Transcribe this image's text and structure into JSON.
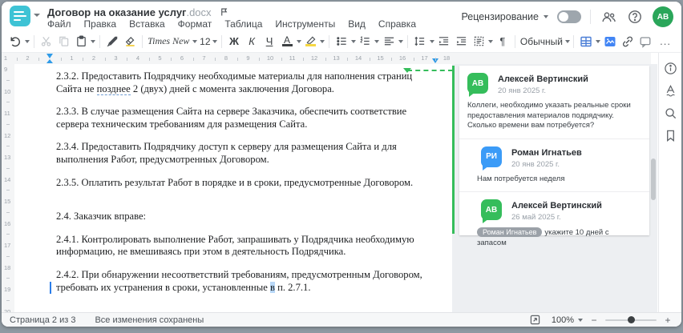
{
  "window": {
    "title": "Договор на оказание услуг",
    "title_extension": ".docx"
  },
  "menu": {
    "items": [
      "Файл",
      "Правка",
      "Вставка",
      "Формат",
      "Таблица",
      "Инструменты",
      "Вид",
      "Справка"
    ]
  },
  "header_right": {
    "review_label": "Рецензирование",
    "toggle_state": "off",
    "avatar_initials": "АВ"
  },
  "toolbar": {
    "font_name": "Times New ...",
    "font_size": "12",
    "bold_label": "Ж",
    "italic_label": "К",
    "underline_label": "Ч",
    "font_color_label": "А",
    "pilcrow_label": "¶",
    "style_name": "Обычный",
    "more_label": "...",
    "icons": [
      "undo",
      "scissors",
      "copy",
      "paste",
      "format-painter",
      "eraser",
      "multilevel-list",
      "bullet-list",
      "numbered-list",
      "align-left",
      "line-spacing",
      "outdent",
      "indent",
      "paragraph-settings",
      "table",
      "image",
      "link",
      "comment",
      "more"
    ]
  },
  "ruler": {
    "left_numbers": [
      "2",
      "1"
    ],
    "numbers": [
      "1",
      "2",
      "3",
      "4",
      "5",
      "6",
      "7",
      "8",
      "9",
      "10",
      "11",
      "12",
      "13",
      "14",
      "15",
      "16",
      "17",
      "18"
    ],
    "v_numbers": [
      "9",
      "10",
      "11",
      "12",
      "13",
      "14",
      "15",
      "16",
      "17",
      "18",
      "19",
      "20"
    ]
  },
  "document": {
    "paragraphs": [
      {
        "runs": [
          {
            "t": "2.3.2. Предоставить Подрядчику необходимые материалы для наполнения страниц Сайта не "
          },
          {
            "t": "позднее",
            "s": "underline"
          },
          {
            "t": " 2 (двух) дней с момента заключения Договора."
          }
        ]
      },
      {
        "runs": [
          {
            "t": "2.3.3. В случае размещения Сайта на сервере Заказчика, обеспечить соответствие сервера техническим требованиям для размещения Сайта."
          }
        ]
      },
      {
        "runs": [
          {
            "t": "2.3.4. Предоставить Подрядчику доступ к серверу для размещения Сайта и для выполнения Работ, предусмотренных Договором."
          }
        ]
      },
      {
        "runs": [
          {
            "t": "2.3.5. Оплатить результат Работ в порядке и в сроки, предусмотренные Договором."
          }
        ]
      },
      {
        "gap": true,
        "runs": [
          {
            "t": "2.4. Заказчик вправе:"
          }
        ]
      },
      {
        "runs": [
          {
            "t": "2.4.1. Контролировать выполнение Работ, запрашивать у Подрядчика необходимую информацию, не вмешиваясь при этом в деятельность Подрядчика."
          }
        ]
      },
      {
        "runs": [
          {
            "t": "2.4.2. При обнаружении несоответствий требованиям, предусмотренным Договором, требовать их устранения в сроки, установленные "
          },
          {
            "t": "в",
            "s": "selection"
          },
          {
            "t": " п. 2.7.1."
          }
        ]
      }
    ]
  },
  "comments": {
    "thread": [
      {
        "initials": "АВ",
        "name": "Алексей Вертинский",
        "date": "20 янв 2025 г.",
        "text": "Коллеги, необходимо указать реальные сроки предоставления материалов подрядчику. Сколько времени вам потребуется?",
        "color": "#35bd5b",
        "reply": false
      },
      {
        "initials": "РИ",
        "name": "Роман Игнатьев",
        "date": "20 янв 2025 г.",
        "text": "Нам потребуется неделя",
        "color": "#3b9bf7",
        "reply": true
      },
      {
        "initials": "АВ",
        "name": "Алексей Вертинский",
        "date": "26 май 2025 г.",
        "mention": "Роман Игнатьев",
        "text": "укажите 10 дней с запасом",
        "color": "#35bd5b",
        "reply": true
      }
    ]
  },
  "sidebar": {
    "icons": [
      "info",
      "spellcheck",
      "search",
      "bookmark"
    ]
  },
  "statusbar": {
    "page_label": "Страница 2 из 3",
    "saved_label": "Все изменения сохранены",
    "zoom_value": "100%",
    "zoom_out_label": "−",
    "zoom_in_label": "+"
  },
  "colors": {
    "accent_teal": "#3ec3d5",
    "comment_green": "#35bd5b",
    "comment_blue": "#3b9bf7",
    "marker_blue": "#2f9be8"
  }
}
